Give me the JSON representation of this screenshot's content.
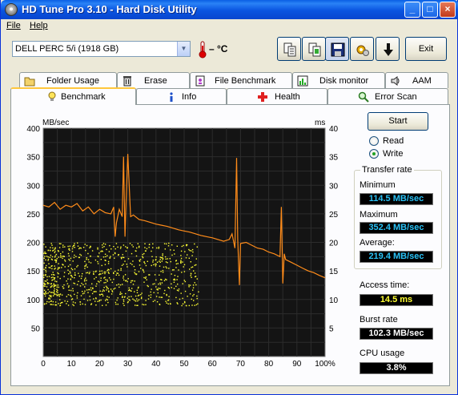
{
  "app": {
    "title": "HD Tune Pro 3.10 - Hard Disk Utility",
    "window_controls": [
      "_",
      "□",
      "×"
    ]
  },
  "menu": {
    "file": "File",
    "help": "Help"
  },
  "toolbar": {
    "drive": "DELL    PERC 5/i (1918 GB)",
    "temperature": "– °C",
    "buttons": [
      "copy-text-icon",
      "copy-screen-icon",
      "save-icon",
      "options-icon",
      "download-arrow-icon"
    ],
    "exit_label": "Exit"
  },
  "tabs_top": [
    {
      "label": "Folder Usage",
      "icon": "folder-icon"
    },
    {
      "label": "Erase",
      "icon": "trash-icon"
    },
    {
      "label": "File Benchmark",
      "icon": "file-benchmark-icon"
    },
    {
      "label": "Disk monitor",
      "icon": "disk-monitor-icon"
    },
    {
      "label": "AAM",
      "icon": "speaker-icon"
    }
  ],
  "tabs_bottom": [
    {
      "label": "Benchmark",
      "icon": "lightbulb-icon",
      "selected": true
    },
    {
      "label": "Info",
      "icon": "info-icon"
    },
    {
      "label": "Health",
      "icon": "health-cross-icon"
    },
    {
      "label": "Error Scan",
      "icon": "magnifier-icon"
    }
  ],
  "controls": {
    "start_label": "Start",
    "read_label": "Read",
    "write_label": "Write",
    "selected_mode": "Write"
  },
  "stats": {
    "transfer_rate_label": "Transfer rate",
    "minimum_label": "Minimum",
    "minimum_value": "114.5 MB/sec",
    "maximum_label": "Maximum",
    "maximum_value": "352.4 MB/sec",
    "average_label": "Average:",
    "average_value": "219.4 MB/sec",
    "access_time_label": "Access time:",
    "access_time_value": "14.5 ms",
    "burst_rate_label": "Burst rate",
    "burst_rate_value": "102.3 MB/sec",
    "cpu_usage_label": "CPU usage",
    "cpu_usage_value": "3.8%"
  },
  "colors": {
    "transfer_line": "#ff8c1a",
    "access_dots": "#ffff33",
    "chart_bg": "#141414",
    "grid": "#2c2c2c",
    "value_blue": "#29c1f5",
    "value_yellow": "#ffff33",
    "value_white": "#ffffff"
  },
  "chart_data": {
    "type": "line",
    "ylabel_left": "MB/sec",
    "ylabel_right": "ms",
    "xlim": [
      0,
      100
    ],
    "ylim_left": [
      0,
      400
    ],
    "ylim_right": [
      0,
      40
    ],
    "x_ticks": [
      "0",
      "10",
      "20",
      "30",
      "40",
      "50",
      "60",
      "70",
      "80",
      "90",
      "100%"
    ],
    "y_ticks_left": [
      "50",
      "100",
      "150",
      "200",
      "250",
      "300",
      "350",
      "400"
    ],
    "y_ticks_right": [
      "5",
      "10",
      "15",
      "20",
      "25",
      "30",
      "35",
      "40"
    ],
    "grid": true,
    "series": [
      {
        "kind": "transfer_rate",
        "x": [
          0,
          2,
          4,
          6,
          8,
          10,
          12,
          14,
          16,
          18,
          20,
          22,
          24,
          25,
          25.5,
          26,
          27,
          28,
          28.5,
          29,
          29.5,
          30,
          31,
          32,
          34,
          36,
          38,
          40,
          42,
          44,
          46,
          48,
          50,
          52,
          54,
          56,
          58,
          60,
          62,
          64,
          66,
          67,
          68,
          68.6,
          69,
          69.6,
          70,
          72,
          74,
          76,
          78,
          80,
          82,
          84,
          84.5,
          85,
          85.5,
          86,
          88,
          90,
          92,
          94,
          96,
          98,
          100
        ],
        "y": [
          265,
          262,
          270,
          258,
          265,
          262,
          268,
          255,
          262,
          250,
          258,
          252,
          250,
          262,
          210,
          235,
          258,
          245,
          350,
          210,
          285,
          355,
          245,
          248,
          240,
          238,
          235,
          232,
          230,
          228,
          225,
          222,
          220,
          218,
          215,
          212,
          210,
          208,
          205,
          202,
          205,
          215,
          190,
          348,
          205,
          125,
          198,
          200,
          195,
          190,
          188,
          183,
          180,
          175,
          262,
          128,
          180,
          170,
          165,
          160,
          155,
          150,
          147,
          142,
          138
        ]
      },
      {
        "kind": "access_time_scatter",
        "x_range": [
          0,
          55
        ],
        "y_range_ms": [
          9,
          20
        ],
        "note_points": 850
      }
    ]
  }
}
